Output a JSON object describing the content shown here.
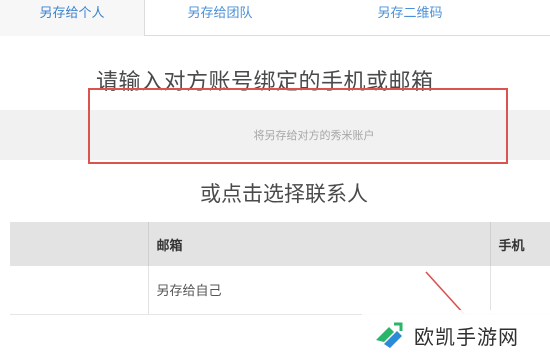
{
  "tabs": [
    {
      "label": "另存给个人",
      "active": true
    },
    {
      "label": "另存给团队",
      "active": false
    },
    {
      "label": "另存二维码",
      "active": false
    }
  ],
  "main": {
    "heading": "请输入对方账号绑定的手机或邮箱",
    "input_placeholder": "将另存给对方的秀米账户",
    "input_value": "",
    "subheading": "或点击选择联系人"
  },
  "contacts_table": {
    "columns": [
      "",
      "邮箱",
      "手机"
    ],
    "rows": [
      {
        "first": "",
        "email": "另存给自己",
        "phone": ""
      }
    ]
  },
  "watermark": {
    "text": "欧凯手游网"
  },
  "colors": {
    "tab_text": "#4a90d9",
    "highlight_border": "#d9534f",
    "table_header_bg": "#e3e3e3",
    "input_row_bg": "#f1f1f1",
    "logo_green": "#2ab56a",
    "logo_blue": "#2a8bd6"
  }
}
